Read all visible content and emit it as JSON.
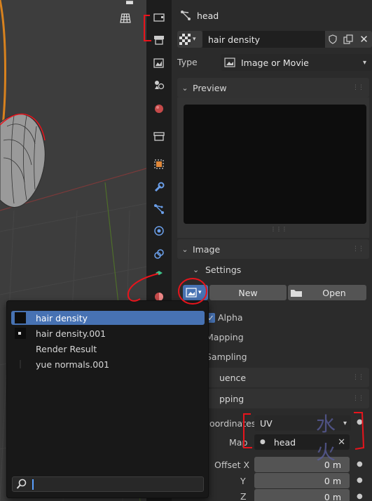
{
  "properties": {
    "object_name": "head",
    "texture_name": "hair density",
    "type_label": "Type",
    "type_value": "Image or Movie",
    "preview_header": "Preview",
    "image_header": "Image",
    "settings_header": "Settings",
    "new_button": "New",
    "open_button": "Open",
    "alpha_label": "Alpha",
    "mapping_label": "Mapping",
    "sampling_label": "Sampling",
    "influence_partial": "uence",
    "mapping_section_partial": "pping",
    "coordinates_label": "oordinates",
    "coordinates_value": "UV",
    "map_label": "Map",
    "map_value": "head",
    "offset_x_label": "Offset X",
    "offset_y_label": "Y",
    "offset_z_label": "Z",
    "offset_x": "0 m",
    "offset_y": "0 m",
    "offset_z": "0 m"
  },
  "popup": {
    "items": [
      {
        "label": "hair density",
        "active": true
      },
      {
        "label": "hair density.001",
        "active": false
      },
      {
        "label": "Render Result",
        "active": false
      },
      {
        "label": "yue normals.001",
        "active": false
      }
    ],
    "search_value": ""
  },
  "watermark": "水火",
  "colors": {
    "accent": "#4772b3",
    "annotation_red": "#e8141c",
    "panel_bg": "#2b2b2b",
    "tabstrip_bg": "#1d1d1d"
  }
}
